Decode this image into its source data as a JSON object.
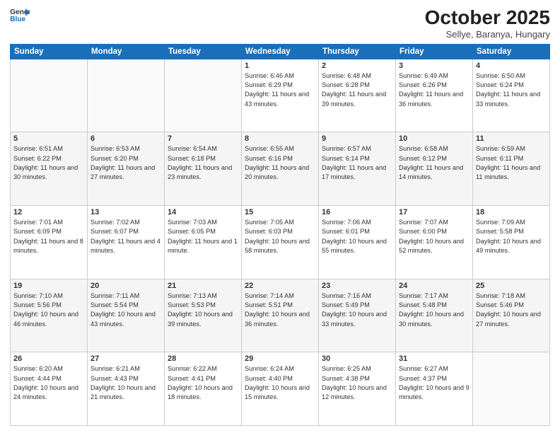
{
  "header": {
    "logo_general": "General",
    "logo_blue": "Blue",
    "month_title": "October 2025",
    "subtitle": "Sellye, Baranya, Hungary"
  },
  "weekdays": [
    "Sunday",
    "Monday",
    "Tuesday",
    "Wednesday",
    "Thursday",
    "Friday",
    "Saturday"
  ],
  "weeks": [
    [
      {
        "day": "",
        "sunrise": "",
        "sunset": "",
        "daylight": ""
      },
      {
        "day": "",
        "sunrise": "",
        "sunset": "",
        "daylight": ""
      },
      {
        "day": "",
        "sunrise": "",
        "sunset": "",
        "daylight": ""
      },
      {
        "day": "1",
        "sunrise": "Sunrise: 6:46 AM",
        "sunset": "Sunset: 6:29 PM",
        "daylight": "Daylight: 11 hours and 43 minutes."
      },
      {
        "day": "2",
        "sunrise": "Sunrise: 6:48 AM",
        "sunset": "Sunset: 6:28 PM",
        "daylight": "Daylight: 11 hours and 39 minutes."
      },
      {
        "day": "3",
        "sunrise": "Sunrise: 6:49 AM",
        "sunset": "Sunset: 6:26 PM",
        "daylight": "Daylight: 11 hours and 36 minutes."
      },
      {
        "day": "4",
        "sunrise": "Sunrise: 6:50 AM",
        "sunset": "Sunset: 6:24 PM",
        "daylight": "Daylight: 11 hours and 33 minutes."
      }
    ],
    [
      {
        "day": "5",
        "sunrise": "Sunrise: 6:51 AM",
        "sunset": "Sunset: 6:22 PM",
        "daylight": "Daylight: 11 hours and 30 minutes."
      },
      {
        "day": "6",
        "sunrise": "Sunrise: 6:53 AM",
        "sunset": "Sunset: 6:20 PM",
        "daylight": "Daylight: 11 hours and 27 minutes."
      },
      {
        "day": "7",
        "sunrise": "Sunrise: 6:54 AM",
        "sunset": "Sunset: 6:18 PM",
        "daylight": "Daylight: 11 hours and 23 minutes."
      },
      {
        "day": "8",
        "sunrise": "Sunrise: 6:55 AM",
        "sunset": "Sunset: 6:16 PM",
        "daylight": "Daylight: 11 hours and 20 minutes."
      },
      {
        "day": "9",
        "sunrise": "Sunrise: 6:57 AM",
        "sunset": "Sunset: 6:14 PM",
        "daylight": "Daylight: 11 hours and 17 minutes."
      },
      {
        "day": "10",
        "sunrise": "Sunrise: 6:58 AM",
        "sunset": "Sunset: 6:12 PM",
        "daylight": "Daylight: 11 hours and 14 minutes."
      },
      {
        "day": "11",
        "sunrise": "Sunrise: 6:59 AM",
        "sunset": "Sunset: 6:11 PM",
        "daylight": "Daylight: 11 hours and 11 minutes."
      }
    ],
    [
      {
        "day": "12",
        "sunrise": "Sunrise: 7:01 AM",
        "sunset": "Sunset: 6:09 PM",
        "daylight": "Daylight: 11 hours and 8 minutes."
      },
      {
        "day": "13",
        "sunrise": "Sunrise: 7:02 AM",
        "sunset": "Sunset: 6:07 PM",
        "daylight": "Daylight: 11 hours and 4 minutes."
      },
      {
        "day": "14",
        "sunrise": "Sunrise: 7:03 AM",
        "sunset": "Sunset: 6:05 PM",
        "daylight": "Daylight: 11 hours and 1 minute."
      },
      {
        "day": "15",
        "sunrise": "Sunrise: 7:05 AM",
        "sunset": "Sunset: 6:03 PM",
        "daylight": "Daylight: 10 hours and 58 minutes."
      },
      {
        "day": "16",
        "sunrise": "Sunrise: 7:06 AM",
        "sunset": "Sunset: 6:01 PM",
        "daylight": "Daylight: 10 hours and 55 minutes."
      },
      {
        "day": "17",
        "sunrise": "Sunrise: 7:07 AM",
        "sunset": "Sunset: 6:00 PM",
        "daylight": "Daylight: 10 hours and 52 minutes."
      },
      {
        "day": "18",
        "sunrise": "Sunrise: 7:09 AM",
        "sunset": "Sunset: 5:58 PM",
        "daylight": "Daylight: 10 hours and 49 minutes."
      }
    ],
    [
      {
        "day": "19",
        "sunrise": "Sunrise: 7:10 AM",
        "sunset": "Sunset: 5:56 PM",
        "daylight": "Daylight: 10 hours and 46 minutes."
      },
      {
        "day": "20",
        "sunrise": "Sunrise: 7:11 AM",
        "sunset": "Sunset: 5:54 PM",
        "daylight": "Daylight: 10 hours and 43 minutes."
      },
      {
        "day": "21",
        "sunrise": "Sunrise: 7:13 AM",
        "sunset": "Sunset: 5:53 PM",
        "daylight": "Daylight: 10 hours and 39 minutes."
      },
      {
        "day": "22",
        "sunrise": "Sunrise: 7:14 AM",
        "sunset": "Sunset: 5:51 PM",
        "daylight": "Daylight: 10 hours and 36 minutes."
      },
      {
        "day": "23",
        "sunrise": "Sunrise: 7:16 AM",
        "sunset": "Sunset: 5:49 PM",
        "daylight": "Daylight: 10 hours and 33 minutes."
      },
      {
        "day": "24",
        "sunrise": "Sunrise: 7:17 AM",
        "sunset": "Sunset: 5:48 PM",
        "daylight": "Daylight: 10 hours and 30 minutes."
      },
      {
        "day": "25",
        "sunrise": "Sunrise: 7:18 AM",
        "sunset": "Sunset: 5:46 PM",
        "daylight": "Daylight: 10 hours and 27 minutes."
      }
    ],
    [
      {
        "day": "26",
        "sunrise": "Sunrise: 6:20 AM",
        "sunset": "Sunset: 4:44 PM",
        "daylight": "Daylight: 10 hours and 24 minutes."
      },
      {
        "day": "27",
        "sunrise": "Sunrise: 6:21 AM",
        "sunset": "Sunset: 4:43 PM",
        "daylight": "Daylight: 10 hours and 21 minutes."
      },
      {
        "day": "28",
        "sunrise": "Sunrise: 6:22 AM",
        "sunset": "Sunset: 4:41 PM",
        "daylight": "Daylight: 10 hours and 18 minutes."
      },
      {
        "day": "29",
        "sunrise": "Sunrise: 6:24 AM",
        "sunset": "Sunset: 4:40 PM",
        "daylight": "Daylight: 10 hours and 15 minutes."
      },
      {
        "day": "30",
        "sunrise": "Sunrise: 6:25 AM",
        "sunset": "Sunset: 4:38 PM",
        "daylight": "Daylight: 10 hours and 12 minutes."
      },
      {
        "day": "31",
        "sunrise": "Sunrise: 6:27 AM",
        "sunset": "Sunset: 4:37 PM",
        "daylight": "Daylight: 10 hours and 9 minutes."
      },
      {
        "day": "",
        "sunrise": "",
        "sunset": "",
        "daylight": ""
      }
    ]
  ]
}
